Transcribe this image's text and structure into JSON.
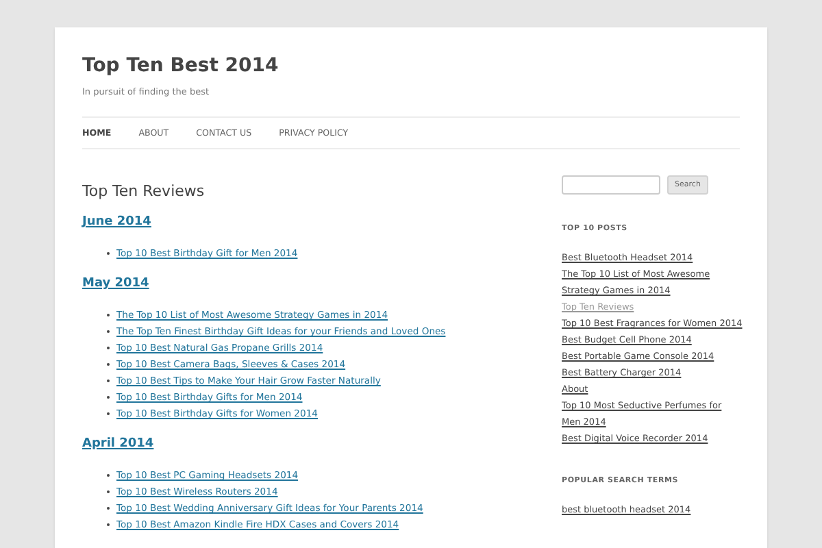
{
  "site": {
    "title": "Top Ten Best 2014",
    "tagline": "In pursuit of finding the best"
  },
  "nav": [
    {
      "label": "HOME",
      "selected": true
    },
    {
      "label": "ABOUT",
      "selected": false
    },
    {
      "label": "CONTACT US",
      "selected": false
    },
    {
      "label": "PRIVACY POLICY",
      "selected": false
    }
  ],
  "page_title": "Top Ten Reviews",
  "sections": [
    {
      "heading": "June 2014",
      "links": [
        "Top 10 Best Birthday Gift for Men 2014"
      ]
    },
    {
      "heading": "May 2014",
      "links": [
        "The Top 10 List of Most Awesome Strategy Games in 2014",
        "The Top Ten Finest Birthday Gift Ideas for your Friends and Loved Ones",
        "Top 10 Best Natural Gas Propane Grills 2014",
        "Top 10 Best Camera Bags, Sleeves & Cases 2014",
        "Top 10 Best Tips to Make Your Hair Grow Faster Naturally",
        "Top 10 Best Birthday Gifts for Men 2014",
        "Top 10 Best Birthday Gifts for Women 2014"
      ]
    },
    {
      "heading": "April 2014",
      "links": [
        "Top 10 Best PC Gaming Headsets 2014",
        "Top 10 Best Wireless Routers 2014",
        "Top 10 Best Wedding Anniversary Gift Ideas for Your Parents 2014",
        "Top 10 Best Amazon Kindle Fire HDX Cases and Covers 2014"
      ]
    }
  ],
  "sidebar": {
    "search_button": "Search",
    "widgets": [
      {
        "title": "TOP 10 POSTS",
        "items": [
          {
            "label": "Best Bluetooth Headset 2014",
            "current": false
          },
          {
            "label": "The Top 10 List of Most Awesome Strategy Games in 2014",
            "current": false
          },
          {
            "label": "Top Ten Reviews",
            "current": true
          },
          {
            "label": "Top 10 Best Fragrances for Women 2014",
            "current": false
          },
          {
            "label": "Best Budget Cell Phone 2014",
            "current": false
          },
          {
            "label": "Best Portable Game Console 2014",
            "current": false
          },
          {
            "label": "Best Battery Charger 2014",
            "current": false
          },
          {
            "label": "About",
            "current": false
          },
          {
            "label": "Top 10 Most Seductive Perfumes for Men 2014",
            "current": false
          },
          {
            "label": "Best Digital Voice Recorder 2014",
            "current": false
          }
        ]
      },
      {
        "title": "POPULAR SEARCH TERMS",
        "items": [
          {
            "label": "best bluetooth headset 2014",
            "current": false
          }
        ]
      }
    ]
  }
}
